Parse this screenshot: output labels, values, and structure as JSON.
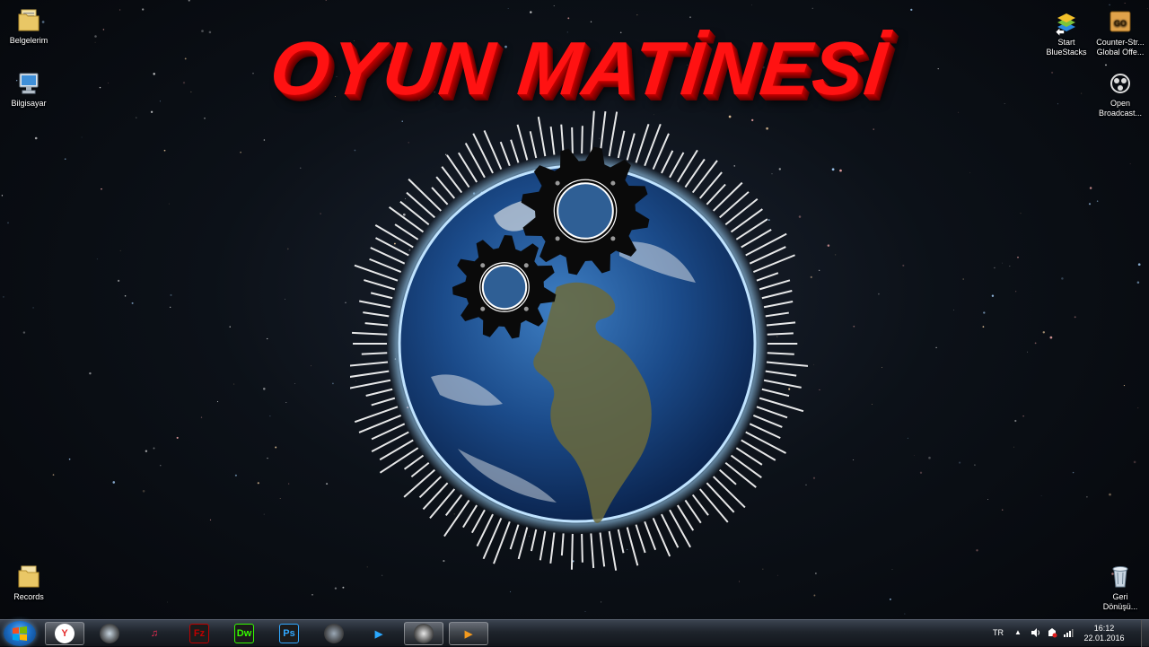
{
  "desktop": {
    "icons_left": [
      {
        "label": "Belgelerim",
        "icon": "folder-icon"
      },
      {
        "label": "Bilgisayar",
        "icon": "computer-icon"
      },
      {
        "label": "Records",
        "icon": "folder-icon"
      }
    ],
    "icons_right": [
      {
        "label": "Start\nBlueStacks",
        "icon": "bluestacks-icon"
      },
      {
        "label": "Counter-Str...\nGlobal Offe...",
        "icon": "counter-strike-icon"
      },
      {
        "label": "Open\nBroadcast...",
        "icon": "obs-icon"
      },
      {
        "label": "Geri\nDönüşü...",
        "icon": "recycle-bin-icon"
      }
    ]
  },
  "wallpaper": {
    "title": "OYUN MATİNESİ",
    "title_color": "#ff1212"
  },
  "taskbar": {
    "apps": [
      {
        "name": "yandex-browser",
        "icon": "yandex-icon",
        "glyph": "Y",
        "color": "#e52b2b",
        "active": true
      },
      {
        "name": "steam",
        "icon": "steam-icon",
        "glyph": "",
        "color": "#c7d5e0",
        "active": false
      },
      {
        "name": "itunes",
        "icon": "itunes-icon",
        "glyph": "♫",
        "color": "#ff2d55",
        "active": false
      },
      {
        "name": "filezilla",
        "icon": "filezilla-icon",
        "glyph": "Fz",
        "color": "#bf0000",
        "active": false
      },
      {
        "name": "dreamweaver",
        "icon": "dreamweaver-icon",
        "glyph": "Dw",
        "color": "#35fa00",
        "active": false
      },
      {
        "name": "photoshop",
        "icon": "photoshop-icon",
        "glyph": "Ps",
        "color": "#31a8ff",
        "active": false
      },
      {
        "name": "audio-app",
        "icon": "audio-app-icon",
        "glyph": "",
        "color": "#9aa7b5",
        "active": false
      },
      {
        "name": "media-player",
        "icon": "media-player-icon",
        "glyph": "▶",
        "color": "#2aa8ff",
        "active": false
      },
      {
        "name": "obs",
        "icon": "obs-icon",
        "glyph": "",
        "color": "#e8e8e8",
        "active": true
      },
      {
        "name": "vlc-or-player",
        "icon": "player-icon",
        "glyph": "▶",
        "color": "#f39a1e",
        "active": true
      }
    ],
    "tray": {
      "language": "TR",
      "time": "16:12",
      "date": "22.01.2016"
    }
  }
}
